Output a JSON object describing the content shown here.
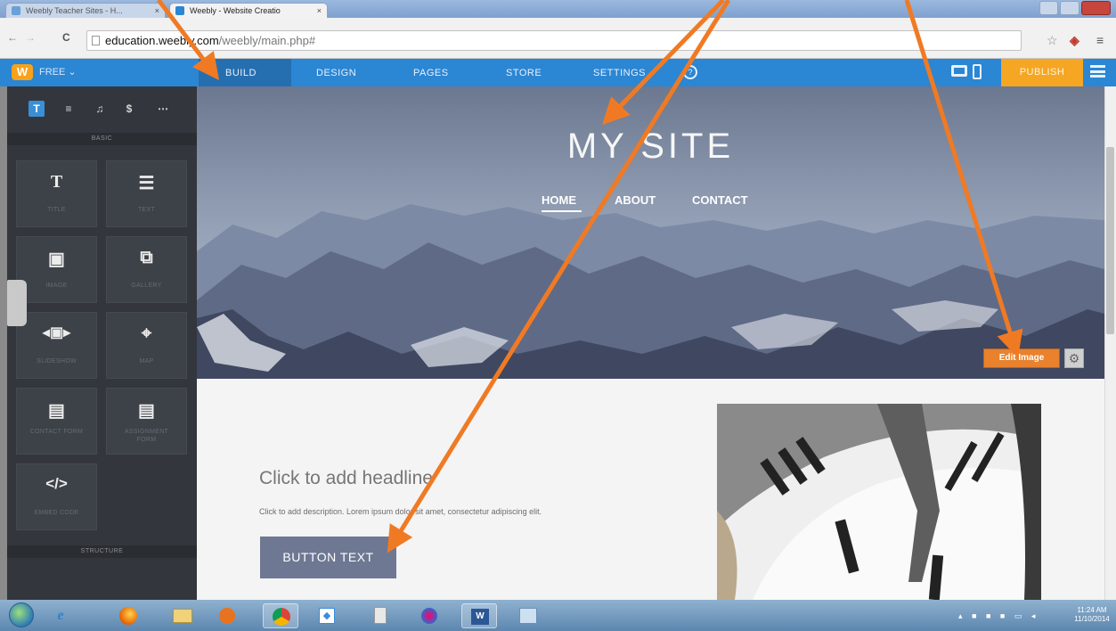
{
  "browser": {
    "tabs": [
      {
        "label": "Weebly Teacher Sites - H...",
        "active": false
      },
      {
        "label": "Weebly - Website Creatio",
        "active": true
      }
    ],
    "url_host": "education.weebly.com",
    "url_path": "/weebly/main.php#",
    "back": "←",
    "forward": "→",
    "reload": "C",
    "star": "☆",
    "menu": "≡"
  },
  "weebly_bar": {
    "logo": "W",
    "plan": "FREE ⌄",
    "tabs": [
      "BUILD",
      "DESIGN",
      "PAGES",
      "STORE",
      "SETTINGS"
    ],
    "active_tab": "BUILD",
    "help": "?",
    "publish": "PUBLISH",
    "colors": {
      "bar": "#2b86d4",
      "publish": "#f5a623"
    }
  },
  "sidebar": {
    "categories": [
      "T",
      "≡",
      "♫",
      "$",
      "⋯"
    ],
    "section_basic": "BASIC",
    "elements": [
      {
        "icon": "T",
        "label": "TITLE"
      },
      {
        "icon": "☰",
        "label": "TEXT"
      },
      {
        "icon": "▣",
        "label": "IMAGE"
      },
      {
        "icon": "⧉",
        "label": "GALLERY"
      },
      {
        "icon": "◂▣▸",
        "label": "SLIDESHOW"
      },
      {
        "icon": "⌖",
        "label": "MAP"
      },
      {
        "icon": "▤",
        "label": "CONTACT FORM"
      },
      {
        "icon": "▤",
        "label": "ASSIGNMENT FORM"
      },
      {
        "icon": "</>",
        "label": "EMBED CODE"
      }
    ],
    "section_structure": "STRUCTURE"
  },
  "site": {
    "title": "MY SITE",
    "nav": [
      "HOME",
      "ABOUT",
      "CONTACT"
    ],
    "edit_image": "Edit Image",
    "gear": "⚙",
    "headline": "Click to add headline",
    "description": "Click to add description. Lorem ipsum dolor sit amet, consectetur adipiscing elit.",
    "button": "BUTTON TEXT"
  },
  "taskbar": {
    "time": "11:24 AM",
    "date": "11/10/2014"
  }
}
